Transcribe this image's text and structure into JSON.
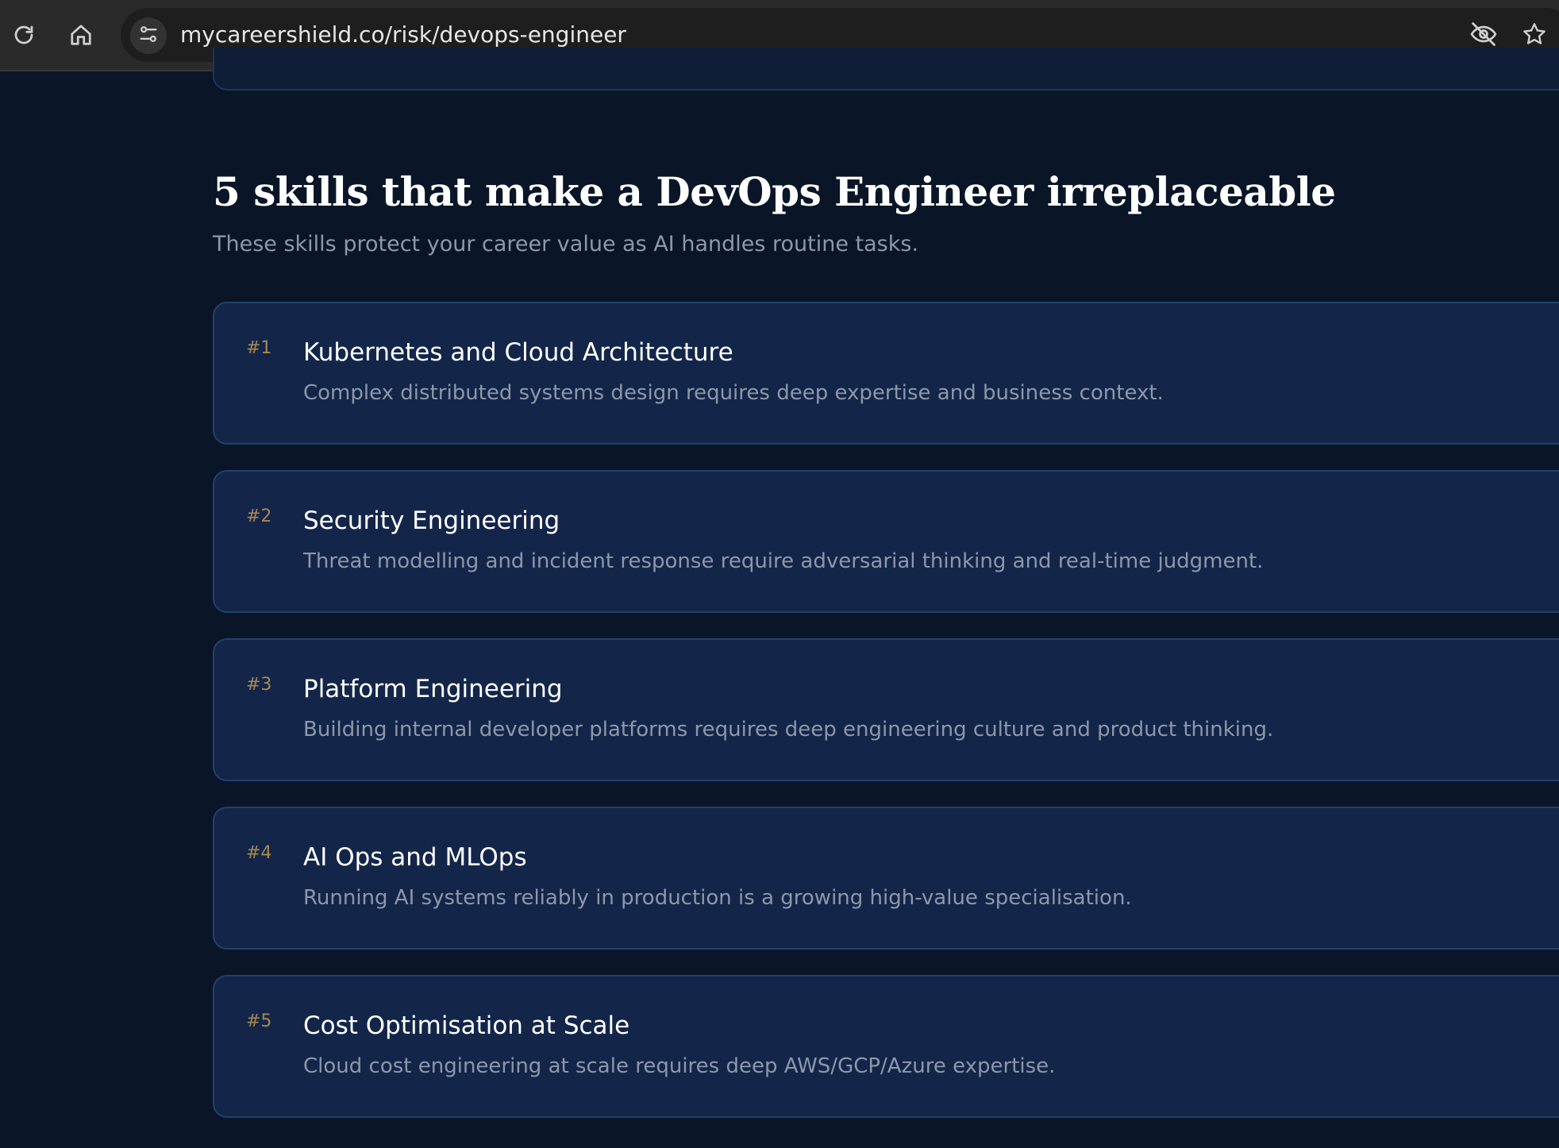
{
  "browser": {
    "url": "mycareershield.co/risk/devops-engineer",
    "icons": [
      "reload-icon",
      "home-icon",
      "site-settings-icon",
      "eye-off-icon",
      "star-icon"
    ]
  },
  "section": {
    "title": "5 skills that make a DevOps Engineer irreplaceable",
    "subtitle": "These skills protect your career value as AI handles routine tasks."
  },
  "skills": [
    {
      "rank": "#1",
      "title": "Kubernetes and Cloud Architecture",
      "description": "Complex distributed systems design requires deep expertise and business context."
    },
    {
      "rank": "#2",
      "title": "Security Engineering",
      "description": "Threat modelling and incident response require adversarial thinking and real-time judgment."
    },
    {
      "rank": "#3",
      "title": "Platform Engineering",
      "description": "Building internal developer platforms requires deep engineering culture and product thinking."
    },
    {
      "rank": "#4",
      "title": "AI Ops and MLOps",
      "description": "Running AI systems reliably in production is a growing high-value specialisation."
    },
    {
      "rank": "#5",
      "title": "Cost Optimisation at Scale",
      "description": "Cloud cost engineering at scale requires deep AWS/GCP/Azure expertise."
    }
  ],
  "colors": {
    "page_background": "#0a1628",
    "card_background": "#13264a",
    "card_border": "#23406a",
    "rank_accent": "#a9894d",
    "muted_text": "#8c98aa"
  }
}
